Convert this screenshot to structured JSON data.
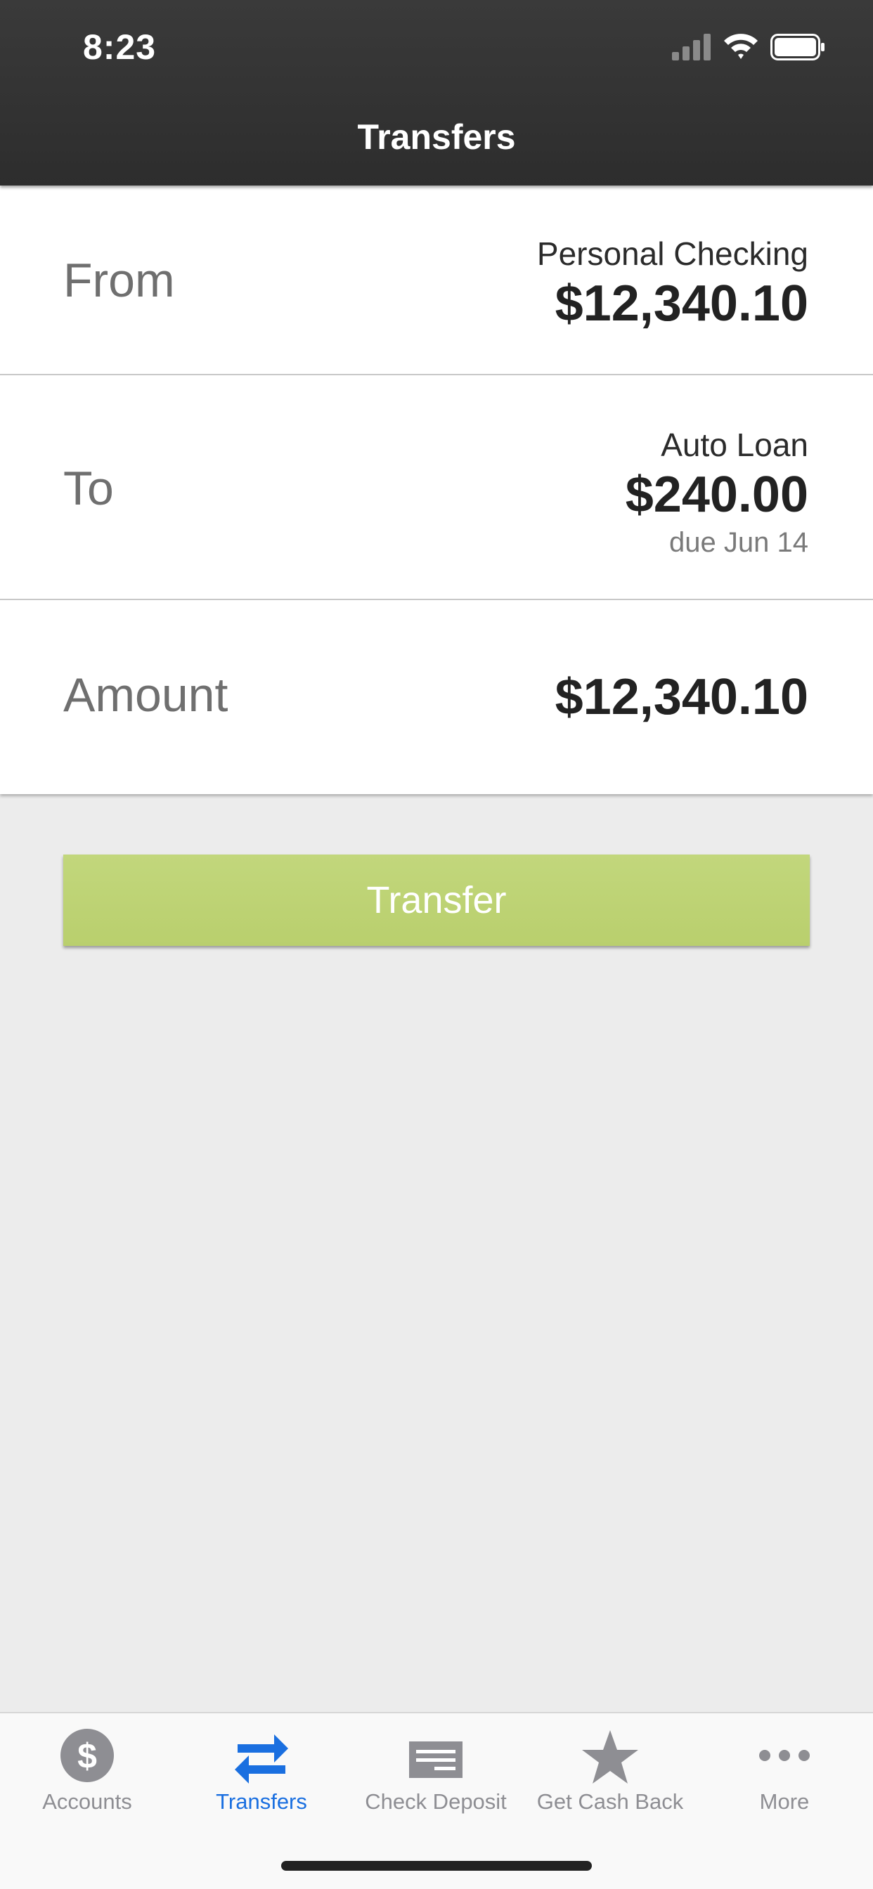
{
  "status_bar": {
    "time": "8:23",
    "icons": [
      "signal-icon",
      "wifi-icon",
      "battery-icon"
    ]
  },
  "header": {
    "title": "Transfers"
  },
  "form": {
    "from": {
      "label": "From",
      "account_name": "Personal Checking",
      "balance": "$12,340.10"
    },
    "to": {
      "label": "To",
      "account_name": "Auto Loan",
      "amount": "$240.00",
      "due": "due Jun 14"
    },
    "amount": {
      "label": "Amount",
      "value": "$12,340.10"
    }
  },
  "actions": {
    "transfer_label": "Transfer",
    "transfer_color": "#c0d577"
  },
  "tabbar": {
    "active_color": "#1a6fe0",
    "inactive_color": "#8e8e93",
    "tabs": [
      {
        "label": "Accounts",
        "icon": "dollar-icon"
      },
      {
        "label": "Transfers",
        "icon": "transfer-arrows-icon",
        "active": true
      },
      {
        "label": "Check Deposit",
        "icon": "check-icon"
      },
      {
        "label": "Get Cash Back",
        "icon": "star-icon"
      },
      {
        "label": "More",
        "icon": "more-dots-icon"
      }
    ]
  }
}
